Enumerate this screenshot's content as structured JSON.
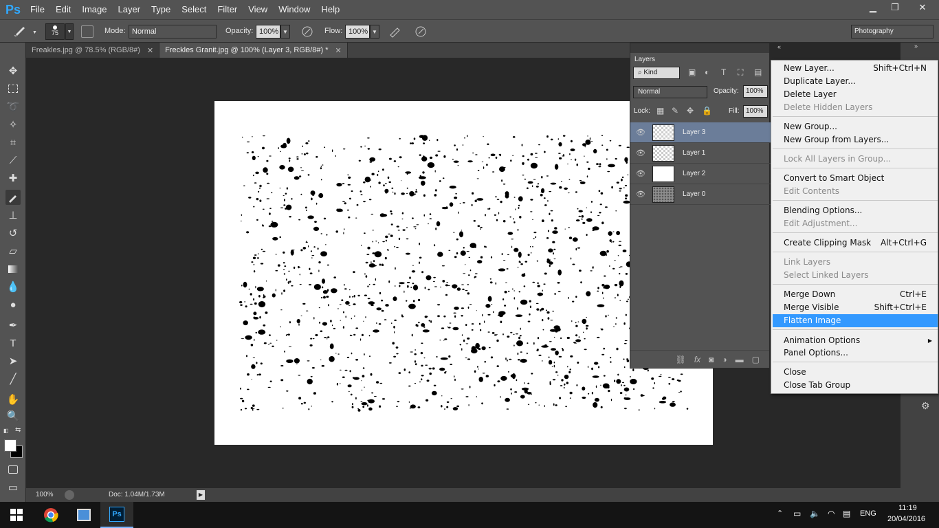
{
  "app": {
    "logo": "Ps"
  },
  "menubar": {
    "items": [
      "File",
      "Edit",
      "Image",
      "Layer",
      "Type",
      "Select",
      "Filter",
      "View",
      "Window",
      "Help"
    ]
  },
  "window_controls": {
    "minimize": "▁",
    "restore": "❐",
    "close": "✕"
  },
  "options": {
    "brush_size": "75",
    "mode_label": "Mode:",
    "mode_value": "Normal",
    "opacity_label": "Opacity:",
    "opacity_value": "100%",
    "flow_label": "Flow:",
    "flow_value": "100%",
    "workspace_value": "Photography"
  },
  "tabs": [
    {
      "label": "Freakles.jpg @ 78.5% (RGB/8#)",
      "close": "✕"
    },
    {
      "label": "Freckles Granit.jpg @ 100% (Layer 3, RGB/8#) *",
      "close": "✕"
    }
  ],
  "status": {
    "zoom": "100%",
    "doc": "Doc: 1.04M/1.73M"
  },
  "layers_panel": {
    "title": "Layers",
    "filter_kind": "Kind",
    "blend_mode": "Normal",
    "opacity_label": "Opacity:",
    "opacity_value": "100%",
    "lock_label": "Lock:",
    "fill_label": "Fill:",
    "fill_value": "100%",
    "layers": [
      {
        "name": "Layer 3",
        "selected": true
      },
      {
        "name": "Layer 1",
        "selected": false
      },
      {
        "name": "Layer 2",
        "selected": false
      },
      {
        "name": "Layer 0",
        "selected": false
      }
    ],
    "footer_fx": "fx"
  },
  "context_menu": {
    "items": [
      {
        "label": "New Layer...",
        "shortcut": "Shift+Ctrl+N",
        "disabled": false
      },
      {
        "label": "Duplicate Layer...",
        "shortcut": "",
        "disabled": false
      },
      {
        "label": "Delete Layer",
        "shortcut": "",
        "disabled": false
      },
      {
        "label": "Delete Hidden Layers",
        "shortcut": "",
        "disabled": true
      },
      {
        "label": "New Group...",
        "shortcut": "",
        "disabled": false
      },
      {
        "label": "New Group from Layers...",
        "shortcut": "",
        "disabled": false
      },
      {
        "label": "Lock All Layers in Group...",
        "shortcut": "",
        "disabled": true
      },
      {
        "label": "Convert to Smart Object",
        "shortcut": "",
        "disabled": false
      },
      {
        "label": "Edit Contents",
        "shortcut": "",
        "disabled": true
      },
      {
        "label": "Blending Options...",
        "shortcut": "",
        "disabled": false
      },
      {
        "label": "Edit Adjustment...",
        "shortcut": "",
        "disabled": true
      },
      {
        "label": "Create Clipping Mask",
        "shortcut": "Alt+Ctrl+G",
        "disabled": false
      },
      {
        "label": "Link Layers",
        "shortcut": "",
        "disabled": true
      },
      {
        "label": "Select Linked Layers",
        "shortcut": "",
        "disabled": true
      },
      {
        "label": "Merge Down",
        "shortcut": "Ctrl+E",
        "disabled": false
      },
      {
        "label": "Merge Visible",
        "shortcut": "Shift+Ctrl+E",
        "disabled": false
      },
      {
        "label": "Flatten Image",
        "shortcut": "",
        "disabled": false,
        "highlighted": true
      },
      {
        "label": "Animation Options",
        "shortcut": "",
        "disabled": false,
        "submenu": true
      },
      {
        "label": "Panel Options...",
        "shortcut": "",
        "disabled": false
      },
      {
        "label": "Close",
        "shortcut": "",
        "disabled": false
      },
      {
        "label": "Close Tab Group",
        "shortcut": "",
        "disabled": false
      }
    ]
  },
  "taskbar": {
    "language": "ENG",
    "time": "11:19",
    "date": "20/04/2016",
    "ps_label": "Ps"
  },
  "colors": {
    "accent": "#3399ff",
    "ps_blue": "#31a8ff",
    "selected_layer": "#6b7d99"
  }
}
